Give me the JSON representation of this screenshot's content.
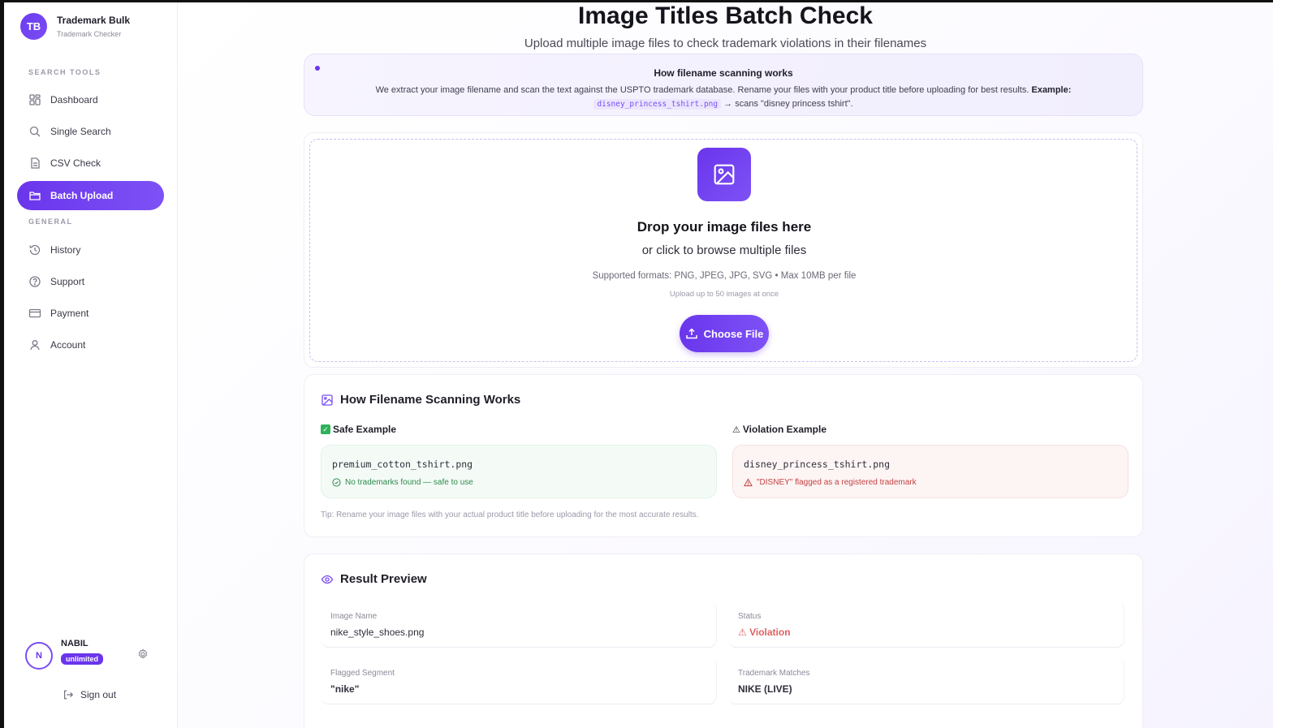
{
  "brand": {
    "initials": "TB",
    "name": "Trademark Bulk",
    "subtitle": "Trademark Checker"
  },
  "sidebar": {
    "section_search": "SEARCH TOOLS",
    "section_general": "GENERAL",
    "items": [
      {
        "label": "Dashboard",
        "icon": "grid-icon"
      },
      {
        "label": "Single Search",
        "icon": "search-icon"
      },
      {
        "label": "CSV Check",
        "icon": "document-icon"
      },
      {
        "label": "Batch Upload",
        "icon": "folder-icon",
        "active": true
      },
      {
        "label": "History",
        "icon": "history-icon"
      },
      {
        "label": "Support",
        "icon": "help-circle-icon"
      },
      {
        "label": "Payment",
        "icon": "credit-card-icon"
      },
      {
        "label": "Account",
        "icon": "user-icon"
      }
    ]
  },
  "user": {
    "initial": "N",
    "name": "NABIL",
    "plan": "unlimited",
    "sign_out": "Sign out"
  },
  "header": {
    "title": "Image Titles Batch Check",
    "subtitle": "Upload multiple image files to check trademark violations in their filenames"
  },
  "info": {
    "title": "How filename scanning works",
    "text": "We extract your image filename and scan the text against the USPTO trademark database. Rename your files with your product title before uploading for best results.",
    "example_label": "Example:",
    "example_code": "disney_princess_tshirt.png",
    "example_result": "→ scans \"disney princess tshirt\"."
  },
  "dropzone": {
    "title": "Drop your image files here",
    "subtitle": "or click to browse multiple files",
    "formats": "Supported formats: PNG, JPEG, JPG, SVG • Max 10MB per file",
    "limit": "Upload up to 50 images at once",
    "button": "Choose File"
  },
  "how": {
    "title": "How Filename Scanning Works",
    "safe_label": "Safe Example",
    "safe_file": "premium_cotton_tshirt.png",
    "safe_note": "No trademarks found — safe to use",
    "violation_label": "Violation Example",
    "violation_file": "disney_princess_tshirt.png",
    "violation_note": "\"DISNEY\" flagged as a registered trademark",
    "tip": "Tip: Rename your image files with your actual product title before uploading for the most accurate results."
  },
  "preview": {
    "title": "Result Preview",
    "image_name_label": "Image Name",
    "image_name_value": "nike_style_shoes.png",
    "status_label": "Status",
    "status_value": "⚠ Violation",
    "flagged_label": "Flagged Segment",
    "flagged_value": "\"nike\"",
    "matches_label": "Trademark Matches",
    "matches_value": "NIKE (LIVE)"
  },
  "colors": {
    "accent": "#6a35ec",
    "success": "#2f8a4d",
    "danger": "#c24242"
  }
}
